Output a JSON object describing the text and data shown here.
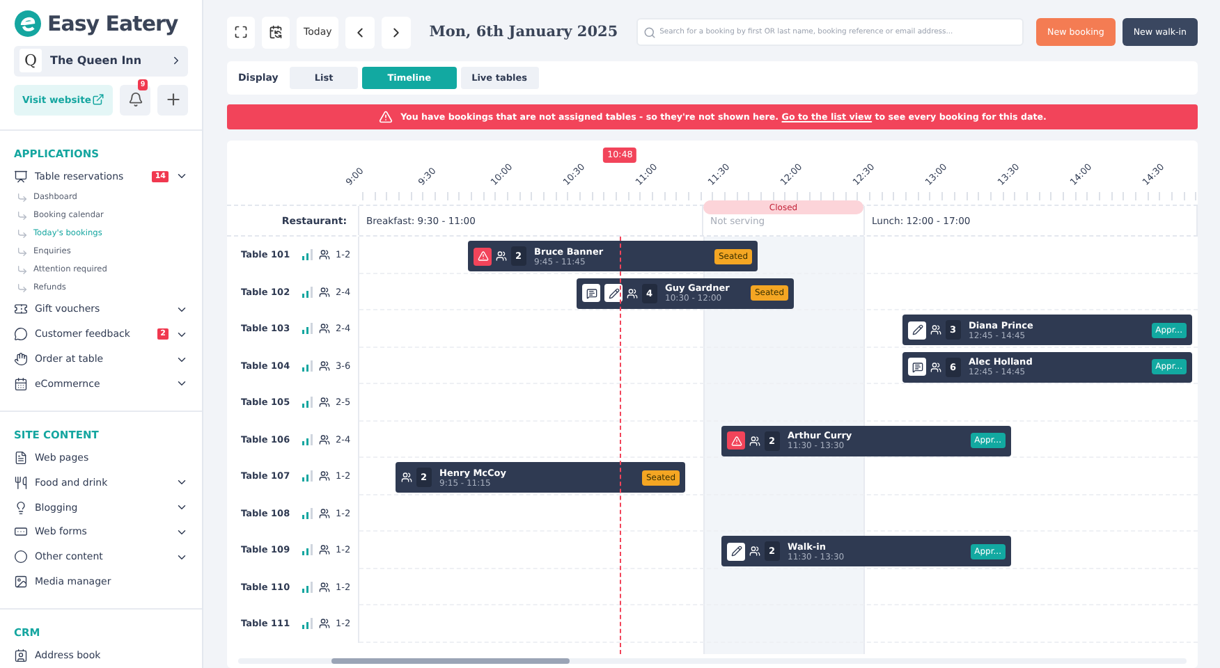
{
  "brand": {
    "name": "Easy Eatery"
  },
  "venue": {
    "initial": "Q",
    "name": "The Queen Inn"
  },
  "visit_website": "Visit website",
  "notifications": {
    "count": "9"
  },
  "sidebar": {
    "sections": [
      {
        "title": "APPLICATIONS",
        "items": [
          {
            "label": "Table reservations",
            "badge": "14",
            "chevron": true,
            "children": [
              {
                "label": "Dashboard",
                "selected": false
              },
              {
                "label": "Booking calendar",
                "selected": false
              },
              {
                "label": "Today's bookings",
                "selected": true
              },
              {
                "label": "Enquiries",
                "selected": false
              },
              {
                "label": "Attention required",
                "selected": false
              },
              {
                "label": "Refunds",
                "selected": false
              }
            ]
          },
          {
            "label": "Gift vouchers",
            "chevron": true
          },
          {
            "label": "Customer feedback",
            "badge": "2",
            "chevron": true
          },
          {
            "label": "Order at table",
            "chevron": true
          },
          {
            "label": "eCommernce",
            "chevron": true
          }
        ]
      },
      {
        "title": "SITE CONTENT",
        "items": [
          {
            "label": "Web pages",
            "chevron": false
          },
          {
            "label": "Food and drink",
            "chevron": true
          },
          {
            "label": "Blogging",
            "chevron": true
          },
          {
            "label": "Web forms",
            "chevron": true
          },
          {
            "label": "Other content",
            "chevron": true
          },
          {
            "label": "Media manager",
            "chevron": false
          }
        ]
      },
      {
        "title": "CRM",
        "items": [
          {
            "label": "Address book",
            "chevron": false
          }
        ]
      }
    ]
  },
  "toolbar": {
    "today": "Today",
    "date": "Mon, 6th January 2025",
    "search": {
      "placeholder": "Search for a booking by first OR last name, booking reference or email address..."
    },
    "buttons": [
      {
        "label": "New booking",
        "kind": "primary"
      },
      {
        "label": "New walk-in",
        "kind": "dark"
      }
    ]
  },
  "display": {
    "label": "Display",
    "options": [
      {
        "label": "List",
        "selected": false
      },
      {
        "label": "Timeline",
        "selected": true
      },
      {
        "label": "Live tables",
        "selected": false
      }
    ]
  },
  "alert": {
    "text": "You have bookings that are not assigned tables - so they're not shown here.",
    "link": "Go to the list view",
    "after": "to see every booking for this date."
  },
  "timeline": {
    "ticks": [
      "9:00",
      "9:30",
      "10:00",
      "10:30",
      "11:00",
      "11:30",
      "12:00",
      "12:30",
      "13:00",
      "13:30",
      "14:00",
      "14:30"
    ],
    "now": "10:48",
    "restaurant_label": "Restaurant:",
    "periods": [
      {
        "kind": "service",
        "label": "Breakfast: 9:30 - 11:00"
      },
      {
        "kind": "closed",
        "badge": "Closed",
        "label": "Not serving"
      },
      {
        "kind": "service",
        "label": "Lunch: 12:00 - 17:00"
      }
    ],
    "tables": [
      {
        "name": "Table 101",
        "covers": "1-2",
        "bookings": [
          {
            "icons": [
              {
                "kind": "warning"
              }
            ],
            "guests": "2",
            "name": "Bruce Banner",
            "time": "9:45 - 11:45",
            "status": "Seated",
            "color": "#f4a623"
          }
        ]
      },
      {
        "name": "Table 102",
        "covers": "2-4",
        "bookings": [
          {
            "icons": [
              {
                "kind": "comment"
              },
              {
                "kind": "edit"
              }
            ],
            "guests": "4",
            "name": "Guy Gardner",
            "time": "10:30 - 12:00",
            "status": "Seated",
            "color": "#f4a623"
          }
        ]
      },
      {
        "name": "Table 103",
        "covers": "2-4",
        "bookings": [
          {
            "icons": [
              {
                "kind": "edit"
              }
            ],
            "guests": "3",
            "name": "Diana Prince",
            "time": "12:45 - 14:45",
            "status": "Appr...",
            "color": "#12a9a1"
          }
        ]
      },
      {
        "name": "Table 104",
        "covers": "3-6",
        "bookings": [
          {
            "icons": [
              {
                "kind": "comment"
              }
            ],
            "guests": "6",
            "name": "Alec Holland",
            "time": "12:45 - 14:45",
            "status": "Appr...",
            "color": "#12a9a1"
          }
        ]
      },
      {
        "name": "Table 105",
        "covers": "2-5"
      },
      {
        "name": "Table 106",
        "covers": "2-4",
        "bookings": [
          {
            "icons": [
              {
                "kind": "warning"
              }
            ],
            "guests": "2",
            "name": "Arthur Curry",
            "time": "11:30 - 13:30",
            "status": "Appr...",
            "color": "#12a9a1"
          }
        ]
      },
      {
        "name": "Table 107",
        "covers": "1-2",
        "bookings": [
          {
            "guests": "2",
            "name": "Henry McCoy",
            "time": "9:15 - 11:15",
            "status": "Seated",
            "color": "#f4a623"
          }
        ]
      },
      {
        "name": "Table 108",
        "covers": "1-2"
      },
      {
        "name": "Table 109",
        "covers": "1-2",
        "bookings": [
          {
            "icons": [
              {
                "kind": "edit"
              }
            ],
            "guests": "2",
            "name": "Walk-in",
            "time": "11:30 - 13:30",
            "status": "Appr...",
            "color": "#12a9a1"
          }
        ]
      },
      {
        "name": "Table 110",
        "covers": "1-2"
      },
      {
        "name": "Table 111",
        "covers": "1-2"
      }
    ]
  }
}
